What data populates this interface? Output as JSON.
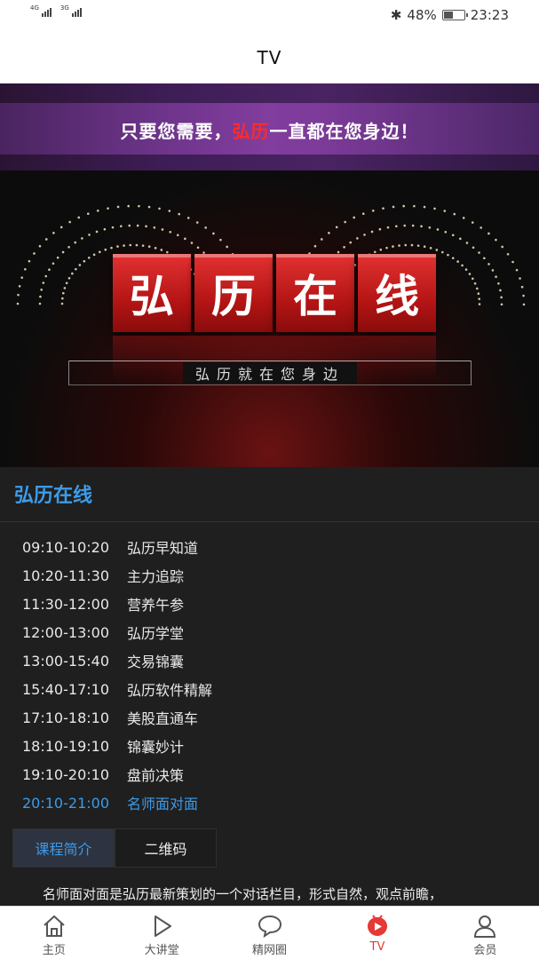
{
  "status_bar": {
    "sim1": "4G",
    "sim2": "3G",
    "battery_percent": "48%",
    "battery_level": 0.48,
    "time": "23:23"
  },
  "header": {
    "title": "TV"
  },
  "banner": {
    "slogan_part1": "只要您需要，",
    "slogan_highlight": "弘历",
    "slogan_part2": "一直都在您身边！",
    "blocks": [
      "弘",
      "历",
      "在",
      "线"
    ],
    "tagline": "弘历就在您身边",
    "accent_color": "#d62020"
  },
  "section": {
    "title": "弘历在线",
    "accent_color": "#3d9be9"
  },
  "schedule": [
    {
      "time": "09:10-10:20",
      "name": "弘历早知道"
    },
    {
      "time": "10:20-11:30",
      "name": "主力追踪"
    },
    {
      "time": "11:30-12:00",
      "name": "营养午参"
    },
    {
      "time": "12:00-13:00",
      "name": "弘历学堂"
    },
    {
      "time": "13:00-15:40",
      "name": "交易锦囊"
    },
    {
      "time": "15:40-17:10",
      "name": "弘历软件精解"
    },
    {
      "time": "17:10-18:10",
      "name": "美股直通车"
    },
    {
      "time": "18:10-19:10",
      "name": "锦囊妙计"
    },
    {
      "time": "19:10-20:10",
      "name": "盘前决策"
    },
    {
      "time": "20:10-21:00",
      "name": "名师面对面",
      "active": true
    }
  ],
  "tabs": [
    {
      "label": "课程简介",
      "active": true
    },
    {
      "label": "二维码",
      "active": false
    }
  ],
  "description": "名师面对面是弘历最新策划的一个对话栏目，形式自然，观点前瞻，",
  "bottom_nav": [
    {
      "label": "主页",
      "icon": "home-icon"
    },
    {
      "label": "大讲堂",
      "icon": "play-icon"
    },
    {
      "label": "精网圈",
      "icon": "chat-bubble-icon"
    },
    {
      "label": "TV",
      "icon": "tv-play-icon",
      "active": true
    },
    {
      "label": "会员",
      "icon": "user-icon"
    }
  ]
}
